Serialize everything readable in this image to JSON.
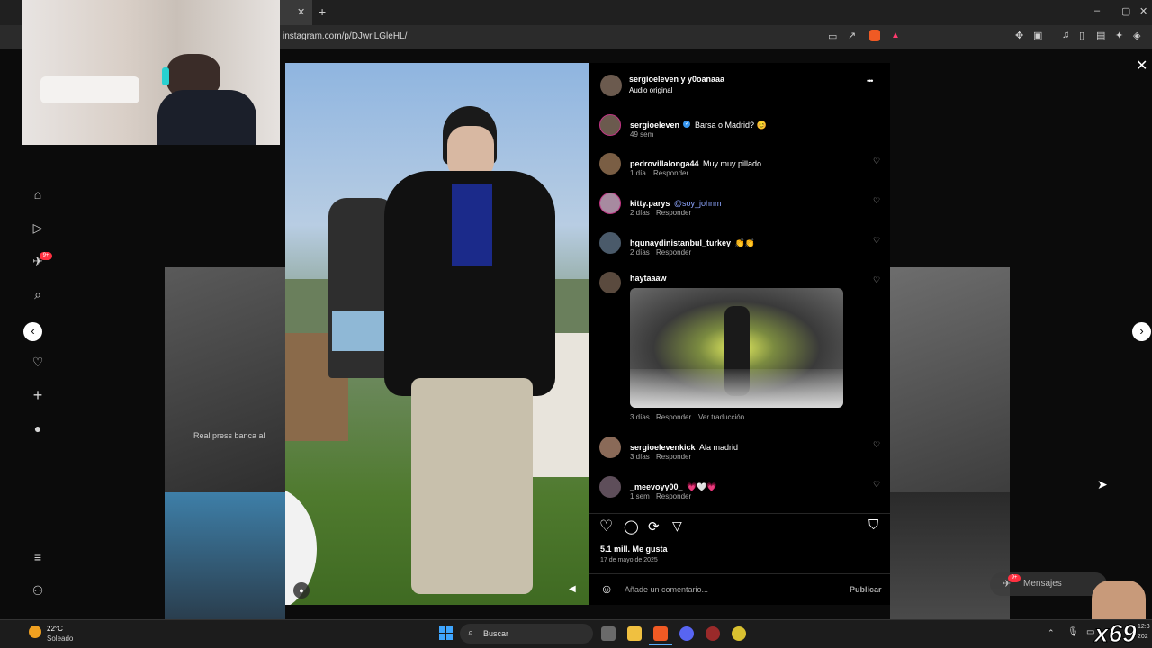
{
  "browser": {
    "url": "instagram.com/p/DJwrjLGleHL/",
    "tab_close": "✕",
    "new_tab": "+"
  },
  "post": {
    "header_user": "sergioeleven y y0oanaaa",
    "header_audio": "Audio original",
    "more": "•••",
    "caption_user": "sergioeleven",
    "caption_text": "Barsa o Madrid? 😊",
    "caption_age": "49 sem",
    "likes": "5.1 mill. Me gusta",
    "date": "17 de mayo de 2025",
    "comment_placeholder": "Añade un comentario...",
    "publish": "Publicar"
  },
  "comments": [
    {
      "user": "pedrovillalonga44",
      "text": "Muy muy pillado",
      "age": "1 día",
      "reply": "Responder"
    },
    {
      "user": "kitty.parys",
      "text": "@soy_johnm",
      "age": "2 días",
      "reply": "Responder"
    },
    {
      "user": "hgunaydinistanbul_turkey",
      "text": "👏👏",
      "age": "2 días",
      "reply": "Responder"
    },
    {
      "user": "haytaaaw",
      "text": "",
      "age": "3 días",
      "reply": "Responder",
      "translate": "Ver traducción"
    },
    {
      "user": "sergioelevenkick",
      "text": "Ala madrid",
      "age": "3 días",
      "reply": "Responder"
    },
    {
      "user": "_meevoyy00_",
      "text": "💗🤍💗",
      "age": "1 sem",
      "reply": "Responder"
    }
  ],
  "background": {
    "tile_text": "Real press banca al",
    "messages": "Mensajes",
    "messages_badge": "9+"
  },
  "nav": {
    "notif_badge": "9+"
  },
  "taskbar": {
    "temp": "22°C",
    "weather": "Soleado",
    "search": "Buscar",
    "clock_time": "12:3",
    "clock_date": "202"
  },
  "watermark": "x69",
  "colors": {
    "mention": "#8ea6ff",
    "verified": "#3897f0",
    "accent": "#c13584"
  }
}
